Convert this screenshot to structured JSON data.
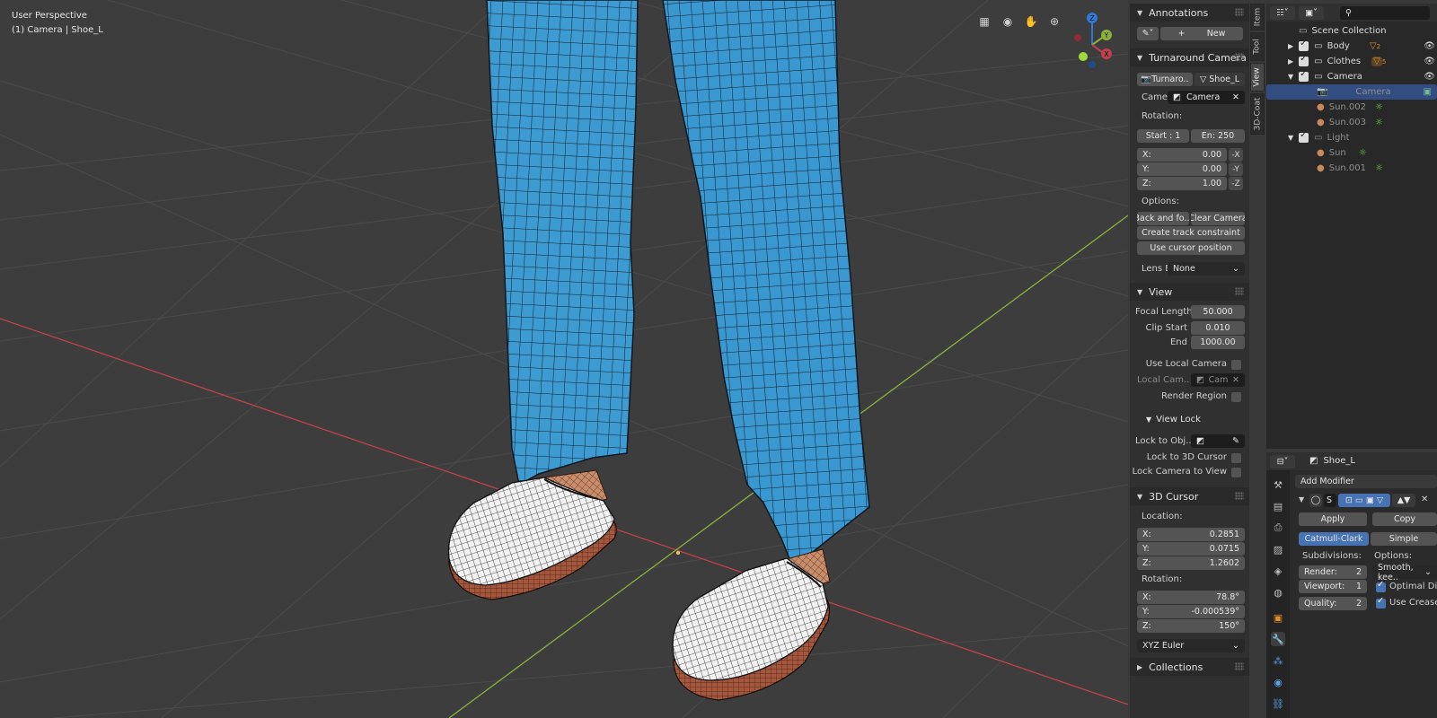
{
  "viewport": {
    "perspective": "User Perspective",
    "object_info": "(1) Camera | Shoe_L",
    "nav_icons": [
      "grid-icon",
      "camera-icon",
      "hand-icon",
      "zoom-icon"
    ],
    "gizmo_axes": [
      "Z",
      "Y",
      "X"
    ]
  },
  "side_tabs": [
    "Item",
    "Tool",
    "View",
    "3D-Coat"
  ],
  "annotations": {
    "title": "Annotations",
    "new_label": "New"
  },
  "turnaround": {
    "title": "Turnaround Camera",
    "tab_camera": "Turnaro..",
    "tab_object": "Shoe_L",
    "camera_label": "Came",
    "camera_value": "Camera",
    "rotation_label": "Rotation:",
    "start": "Start : 1",
    "end": "En:  250",
    "x_label": "X:",
    "x_value": "0.00",
    "x_neg": "-X",
    "y_label": "Y:",
    "y_value": "0.00",
    "y_neg": "-Y",
    "z_label": "Z:",
    "z_value": "1.00",
    "z_neg": "-Z",
    "options_label": "Options:",
    "back_forth": "Back and fo...",
    "clear_camera": "Clear Camera",
    "track_constraint": "Create track constraint",
    "cursor_position": "Use cursor position",
    "lens_label": "Lens E",
    "lens_value": "None"
  },
  "view": {
    "title": "View",
    "focal_label": "Focal Length",
    "focal_value": "50.000",
    "clip_start_label": "Clip Start",
    "clip_start_value": "0.010",
    "end_label": "End",
    "end_value": "1000.00",
    "local_camera_label": "Use Local Camera",
    "local_cam_label": "Local Cam..",
    "local_cam_value": "Cam",
    "render_region_label": "Render Region",
    "view_lock_title": "View Lock",
    "lock_obj_label": "Lock to Obj..",
    "lock_cursor_label": "Lock to 3D Cursor",
    "lock_camera_label": "Lock Camera to View"
  },
  "cursor": {
    "title": "3D Cursor",
    "location_label": "Location:",
    "loc_x": "0.2851",
    "loc_y": "0.0715",
    "loc_z": "1.2602",
    "rotation_label": "Rotation:",
    "rot_x": "78.8°",
    "rot_y": "-0.000539°",
    "rot_z": "150°",
    "mode": "XYZ Euler",
    "x_label": "X:",
    "y_label": "Y:",
    "z_label": "Z:"
  },
  "collections": {
    "title": "Collections"
  },
  "outliner": {
    "scene_collection": "Scene Collection",
    "items": [
      {
        "label": "Body",
        "badge": "2"
      },
      {
        "label": "Clothes",
        "badge": "5"
      },
      {
        "label": "Camera"
      },
      {
        "label": "Camera"
      },
      {
        "label": "Sun.002"
      },
      {
        "label": "Sun.003"
      },
      {
        "label": "Light"
      },
      {
        "label": "Sun"
      },
      {
        "label": "Sun.001"
      }
    ]
  },
  "properties": {
    "object_name": "Shoe_L",
    "add_modifier": "Add Modifier",
    "modifier_name": "S",
    "apply": "Apply",
    "copy": "Copy",
    "catmull": "Catmull-Clark",
    "simple": "Simple",
    "subdivisions_label": "Subdivisions:",
    "options_label": "Options:",
    "render_label": "Render:",
    "render_value": "2",
    "viewport_label": "Viewport:",
    "viewport_value": "1",
    "quality_label": "Quality:",
    "quality_value": "2",
    "smooth_label": "Smooth, kee..",
    "optimal_label": "Optimal Di..",
    "creases_label": "Use Creases"
  },
  "colors": {
    "pants": "#3e9bd2",
    "accent": "#4772b3",
    "x_axis": "#c0414d",
    "y_axis": "#8bb13a",
    "selection": "#334d80"
  }
}
